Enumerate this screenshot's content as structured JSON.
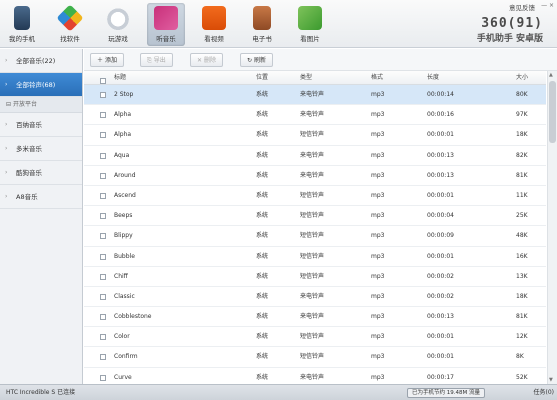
{
  "nav": [
    {
      "label": "我的手机",
      "icon": "phone-icon",
      "cls": "ico-phone"
    },
    {
      "label": "找软件",
      "icon": "software-icon",
      "cls": "ico-soft"
    },
    {
      "label": "玩游戏",
      "icon": "gamepad-icon",
      "cls": "ico-game"
    },
    {
      "label": "听音乐",
      "icon": "music-icon",
      "cls": "ico-music",
      "active": true
    },
    {
      "label": "看视频",
      "icon": "video-icon",
      "cls": "ico-video"
    },
    {
      "label": "电子书",
      "icon": "book-icon",
      "cls": "ico-book"
    },
    {
      "label": "看图片",
      "icon": "picture-icon",
      "cls": "ico-pic"
    }
  ],
  "header": {
    "feedback": "意见反馈",
    "brand_line1": "360(91)",
    "brand_line2": "手机助手 安卓版"
  },
  "sidebar": {
    "items_top": [
      {
        "label": "全部音乐(22)",
        "active": false
      },
      {
        "label": "全部铃声(68)",
        "active": true
      }
    ],
    "section": "开放平台",
    "items_bottom": [
      {
        "label": "百纳音乐"
      },
      {
        "label": "多米音乐"
      },
      {
        "label": "酷狗音乐"
      },
      {
        "label": "A8音乐"
      }
    ]
  },
  "toolbar": {
    "add": "添加",
    "export": "导出",
    "delete": "删除",
    "refresh": "刷新"
  },
  "table": {
    "headers": {
      "title": "标题",
      "location": "位置",
      "type": "类型",
      "format": "格式",
      "duration": "长度",
      "size": "大小"
    },
    "rows": [
      {
        "title": "2 Stop",
        "location": "系统",
        "type": "来电铃声",
        "format": "mp3",
        "duration": "00:00:14",
        "size": "80K",
        "selected": true
      },
      {
        "title": "Alpha",
        "location": "系统",
        "type": "来电铃声",
        "format": "mp3",
        "duration": "00:00:16",
        "size": "97K"
      },
      {
        "title": "Alpha",
        "location": "系统",
        "type": "短信铃声",
        "format": "mp3",
        "duration": "00:00:01",
        "size": "18K"
      },
      {
        "title": "Aqua",
        "location": "系统",
        "type": "来电铃声",
        "format": "mp3",
        "duration": "00:00:13",
        "size": "82K"
      },
      {
        "title": "Around",
        "location": "系统",
        "type": "来电铃声",
        "format": "mp3",
        "duration": "00:00:13",
        "size": "81K"
      },
      {
        "title": "Ascend",
        "location": "系统",
        "type": "短信铃声",
        "format": "mp3",
        "duration": "00:00:01",
        "size": "11K"
      },
      {
        "title": "Beeps",
        "location": "系统",
        "type": "短信铃声",
        "format": "mp3",
        "duration": "00:00:04",
        "size": "25K"
      },
      {
        "title": "Blippy",
        "location": "系统",
        "type": "短信铃声",
        "format": "mp3",
        "duration": "00:00:09",
        "size": "48K"
      },
      {
        "title": "Bubble",
        "location": "系统",
        "type": "短信铃声",
        "format": "mp3",
        "duration": "00:00:01",
        "size": "16K"
      },
      {
        "title": "Chiff",
        "location": "系统",
        "type": "短信铃声",
        "format": "mp3",
        "duration": "00:00:02",
        "size": "13K"
      },
      {
        "title": "Classic",
        "location": "系统",
        "type": "来电铃声",
        "format": "mp3",
        "duration": "00:00:02",
        "size": "18K"
      },
      {
        "title": "Cobblestone",
        "location": "系统",
        "type": "来电铃声",
        "format": "mp3",
        "duration": "00:00:13",
        "size": "81K"
      },
      {
        "title": "Color",
        "location": "系统",
        "type": "短信铃声",
        "format": "mp3",
        "duration": "00:00:01",
        "size": "12K"
      },
      {
        "title": "Confirm",
        "location": "系统",
        "type": "短信铃声",
        "format": "mp3",
        "duration": "00:00:01",
        "size": "8K"
      },
      {
        "title": "Curve",
        "location": "系统",
        "type": "来电铃声",
        "format": "mp3",
        "duration": "00:00:17",
        "size": "52K"
      }
    ]
  },
  "status": {
    "device": "HTC Incredible S 已连接",
    "storage": "已为手机节约 19.48M 流量",
    "task": "任务(0)"
  }
}
